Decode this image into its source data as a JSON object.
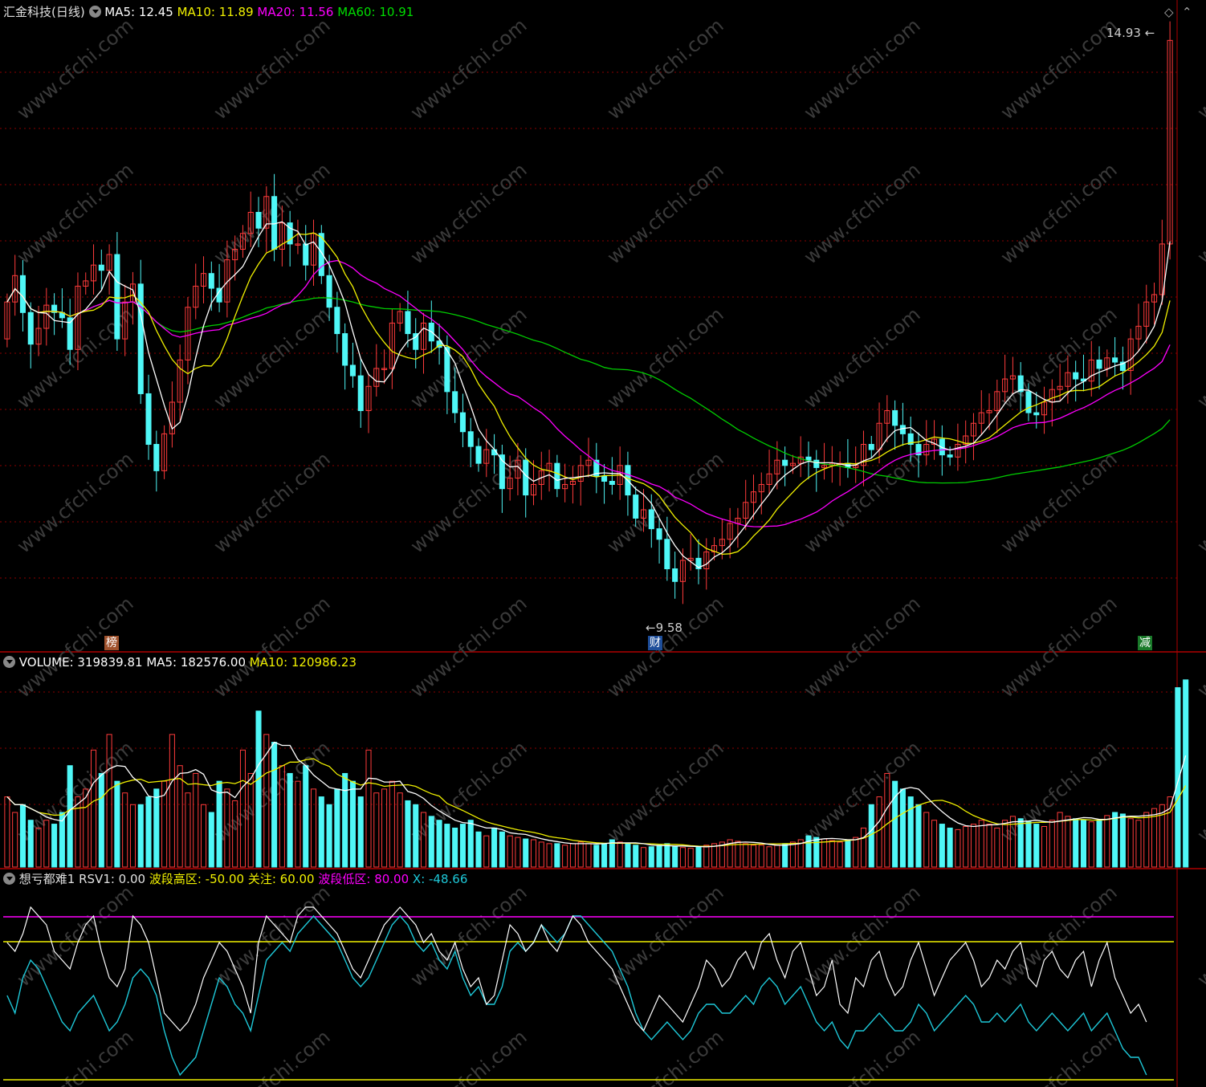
{
  "colors": {
    "up": "#ff3b3b",
    "down": "#4ff7f7",
    "ma5": "#ffffff",
    "ma10": "#f0f000",
    "ma20": "#ff00ff",
    "ma60": "#00cc00",
    "grid": "#8b0000",
    "rsv": "#ffffff",
    "x": "#1ec8d8"
  },
  "header": {
    "stock": "汇金科技(日线)",
    "ma5": "MA5: 12.45",
    "ma10": "MA10: 11.89",
    "ma20": "MA20: 11.56",
    "ma60": "MA60: 10.91"
  },
  "volume_header": {
    "volume": "VOLUME: 319839.81",
    "ma5": "MA5: 182576.00",
    "ma10": "MA10: 120986.23"
  },
  "indicator_header": {
    "name": "想亏都难1",
    "rsv1": "RSV1: 0.00",
    "high_zone": "波段高区: -50.00",
    "watch": "关注: 60.00",
    "low_zone": "波段低区: 80.00",
    "x": "X: -48.66"
  },
  "annotations": {
    "high_price": "14.93",
    "low_price": "9.58",
    "badge_bang": "榜",
    "badge_cai": "财",
    "badge_jian": "减"
  },
  "watermark": "www.cfchi.com",
  "chart_data": [
    {
      "type": "candlestick",
      "title": "汇金科技(日线)",
      "y_range": [
        9.3,
        15.1
      ],
      "high": 14.93,
      "low": 9.58,
      "closes": [
        12.45,
        12.7,
        12.35,
        12.05,
        12.2,
        12.42,
        12.35,
        12.3,
        12.0,
        12.6,
        12.65,
        12.8,
        12.75,
        12.9,
        12.1,
        12.45,
        12.62,
        11.58,
        11.1,
        10.85,
        11.2,
        11.5,
        11.9,
        12.4,
        12.6,
        12.72,
        12.58,
        12.45,
        12.85,
        12.95,
        13.1,
        13.3,
        13.15,
        13.45,
        12.95,
        13.2,
        13.0,
        13.0,
        12.8,
        13.1,
        12.7,
        12.4,
        12.15,
        11.85,
        11.75,
        11.42,
        11.65,
        11.82,
        11.82,
        12.25,
        12.36,
        12.15,
        12.0,
        12.25,
        12.08,
        12.02,
        11.6,
        11.4,
        11.22,
        11.08,
        10.92,
        11.05,
        11.0,
        10.68,
        10.78,
        10.95,
        10.62,
        10.72,
        10.85,
        10.92,
        10.68,
        10.72,
        10.75,
        10.9,
        10.95,
        10.8,
        10.75,
        10.72,
        10.9,
        10.62,
        10.4,
        10.48,
        10.3,
        10.2,
        9.92,
        9.8,
        10.0,
        10.02,
        9.92,
        10.08,
        10.14,
        10.2,
        10.35,
        10.4,
        10.55,
        10.65,
        10.72,
        10.82,
        10.95,
        10.9,
        10.92,
        10.98,
        10.95,
        10.88,
        10.9,
        10.92,
        10.92,
        10.88,
        10.9,
        11.1,
        11.05,
        11.3,
        11.42,
        11.28,
        11.2,
        11.1,
        11.0,
        11.1,
        11.15,
        11.0,
        10.98,
        11.1,
        11.18,
        11.3,
        11.4,
        11.42,
        11.6,
        11.72,
        11.75,
        11.6,
        11.4,
        11.38,
        11.5,
        11.62,
        11.65,
        11.78,
        11.72,
        11.7,
        11.9,
        11.82,
        11.92,
        11.88,
        11.8,
        12.1,
        12.22,
        12.45,
        12.52,
        13.0,
        14.93
      ],
      "opens": [
        12.1,
        12.45,
        12.7,
        12.35,
        12.05,
        12.2,
        12.42,
        12.35,
        12.3,
        12.0,
        12.6,
        12.65,
        12.8,
        12.75,
        12.9,
        12.1,
        12.45,
        12.62,
        11.58,
        11.1,
        10.85,
        11.2,
        11.5,
        11.9,
        12.4,
        12.6,
        12.72,
        12.58,
        12.45,
        12.85,
        12.95,
        13.1,
        13.3,
        13.15,
        13.45,
        12.95,
        13.2,
        13.0,
        13.0,
        12.8,
        13.1,
        12.7,
        12.4,
        12.15,
        11.85,
        11.75,
        11.42,
        11.65,
        11.82,
        11.82,
        12.25,
        12.36,
        12.15,
        12.0,
        12.25,
        12.08,
        12.02,
        11.6,
        11.4,
        11.22,
        11.08,
        10.92,
        11.05,
        11.0,
        10.68,
        10.78,
        10.95,
        10.62,
        10.72,
        10.85,
        10.92,
        10.68,
        10.72,
        10.75,
        10.9,
        10.95,
        10.8,
        10.75,
        10.72,
        10.9,
        10.62,
        10.4,
        10.48,
        10.3,
        10.2,
        9.92,
        9.8,
        10.0,
        10.02,
        9.92,
        10.08,
        10.14,
        10.2,
        10.35,
        10.4,
        10.55,
        10.65,
        10.72,
        10.82,
        10.95,
        10.9,
        10.92,
        10.98,
        10.95,
        10.88,
        10.9,
        10.92,
        10.92,
        10.88,
        10.9,
        11.1,
        11.05,
        11.3,
        11.42,
        11.28,
        11.2,
        11.1,
        11.0,
        11.1,
        11.15,
        11.0,
        10.98,
        11.1,
        11.18,
        11.3,
        11.4,
        11.42,
        11.6,
        11.72,
        11.75,
        11.6,
        11.4,
        11.38,
        11.5,
        11.62,
        11.65,
        11.78,
        11.72,
        11.7,
        11.9,
        11.82,
        11.92,
        11.88,
        11.8,
        12.1,
        12.22,
        12.45,
        12.52,
        13.0
      ]
    },
    {
      "type": "bar",
      "title": "VOLUME",
      "values": [
        90,
        70,
        80,
        60,
        50,
        60,
        55,
        70,
        130,
        90,
        100,
        150,
        120,
        170,
        110,
        95,
        80,
        80,
        90,
        100,
        110,
        170,
        130,
        95,
        120,
        80,
        70,
        110,
        100,
        85,
        150,
        120,
        200,
        170,
        160,
        130,
        120,
        110,
        130,
        100,
        90,
        80,
        100,
        120,
        110,
        90,
        150,
        95,
        100,
        110,
        95,
        85,
        80,
        70,
        65,
        60,
        55,
        50,
        55,
        60,
        45,
        40,
        50,
        45,
        40,
        38,
        36,
        35,
        32,
        30,
        30,
        28,
        30,
        32,
        30,
        28,
        30,
        35,
        32,
        30,
        28,
        25,
        26,
        28,
        30,
        26,
        25,
        24,
        26,
        28,
        30,
        32,
        35,
        33,
        30,
        28,
        28,
        26,
        28,
        30,
        32,
        35,
        40,
        38,
        36,
        34,
        32,
        35,
        38,
        50,
        80,
        90,
        120,
        110,
        100,
        90,
        80,
        70,
        60,
        55,
        50,
        48,
        52,
        55,
        60,
        55,
        50,
        60,
        65,
        62,
        58,
        55,
        52,
        60,
        70,
        65,
        62,
        60,
        58,
        60,
        66,
        70,
        68,
        62,
        60,
        70,
        75,
        80,
        90,
        230,
        240
      ]
    },
    {
      "type": "line",
      "title": "想亏都难1",
      "y_range": [
        -100,
        10
      ],
      "series": [
        {
          "name": "RSV1",
          "values": [
            -20,
            -25,
            -15,
            0,
            -5,
            -10,
            -25,
            -30,
            -35,
            -20,
            -10,
            -5,
            -25,
            -40,
            -45,
            -35,
            -5,
            -10,
            -20,
            -40,
            -60,
            -65,
            -70,
            -65,
            -55,
            -40,
            -30,
            -20,
            -25,
            -35,
            -45,
            -60,
            -20,
            -5,
            -10,
            -15,
            -20,
            -5,
            0,
            0,
            -5,
            -10,
            -15,
            -25,
            -35,
            -40,
            -30,
            -20,
            -10,
            -5,
            0,
            -5,
            -10,
            -20,
            -15,
            -25,
            -30,
            -20,
            -35,
            -45,
            -40,
            -55,
            -50,
            -30,
            -10,
            -15,
            -25,
            -20,
            -10,
            -20,
            -25,
            -15,
            -5,
            -10,
            -20,
            -25,
            -30,
            -35,
            -45,
            -55,
            -65,
            -70,
            -60,
            -50,
            -55,
            -60,
            -65,
            -55,
            -45,
            -30,
            -35,
            -45,
            -40,
            -30,
            -25,
            -35,
            -20,
            -15,
            -30,
            -40,
            -25,
            -20,
            -35,
            -50,
            -45,
            -30,
            -55,
            -60,
            -40,
            -45,
            -30,
            -25,
            -40,
            -50,
            -45,
            -30,
            -20,
            -35,
            -50,
            -40,
            -30,
            -25,
            -20,
            -30,
            -45,
            -40,
            -30,
            -35,
            -25,
            -20,
            -40,
            -45,
            -30,
            -25,
            -35,
            -40,
            -30,
            -25,
            -45,
            -30,
            -20,
            -40,
            -50,
            -60,
            -55,
            -65
          ]
        },
        {
          "name": "X",
          "values": [
            -50,
            -60,
            -40,
            -30,
            -35,
            -45,
            -55,
            -65,
            -70,
            -60,
            -55,
            -50,
            -60,
            -70,
            -65,
            -55,
            -40,
            -35,
            -40,
            -50,
            -70,
            -85,
            -95,
            -90,
            -85,
            -70,
            -55,
            -40,
            -45,
            -55,
            -60,
            -70,
            -50,
            -30,
            -25,
            -20,
            -25,
            -15,
            -10,
            -5,
            -10,
            -15,
            -20,
            -30,
            -40,
            -45,
            -40,
            -30,
            -20,
            -10,
            -5,
            -10,
            -20,
            -25,
            -20,
            -30,
            -35,
            -25,
            -40,
            -50,
            -45,
            -55,
            -55,
            -45,
            -25,
            -20,
            -25,
            -20,
            -10,
            -15,
            -20,
            -15,
            -5,
            -5,
            -10,
            -15,
            -20,
            -25,
            -35,
            -45,
            -60,
            -70,
            -75,
            -70,
            -65,
            -70,
            -75,
            -70,
            -60,
            -55,
            -55,
            -60,
            -60,
            -55,
            -50,
            -55,
            -45,
            -40,
            -45,
            -55,
            -50,
            -45,
            -55,
            -65,
            -70,
            -65,
            -75,
            -80,
            -70,
            -70,
            -65,
            -60,
            -65,
            -70,
            -70,
            -65,
            -55,
            -60,
            -70,
            -65,
            -60,
            -55,
            -50,
            -55,
            -65,
            -65,
            -60,
            -65,
            -60,
            -55,
            -65,
            -70,
            -65,
            -60,
            -65,
            -70,
            -65,
            -60,
            -70,
            -65,
            -60,
            -70,
            -80,
            -85,
            -85,
            -95
          ]
        }
      ],
      "reference_lines": [
        -50,
        60,
        80
      ]
    }
  ]
}
